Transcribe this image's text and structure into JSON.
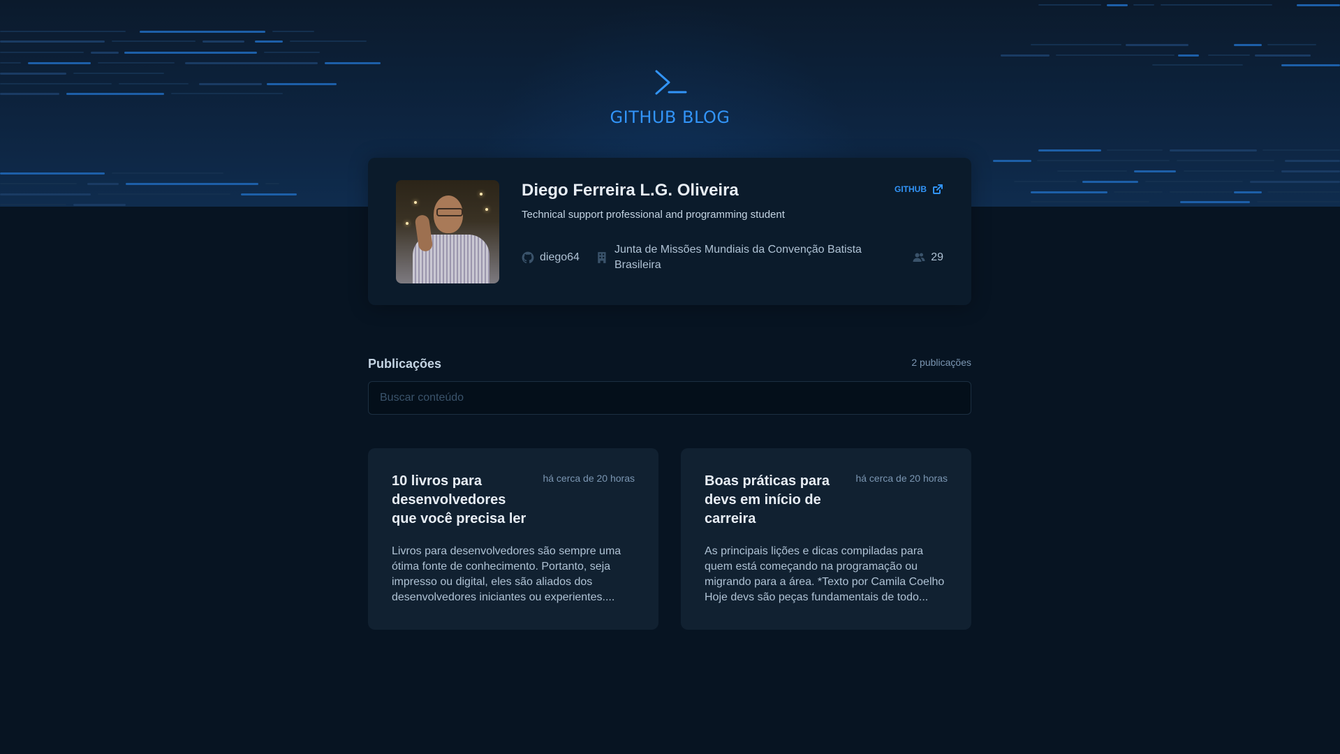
{
  "header": {
    "title": "GITHUB BLOG",
    "icon": "terminal-prompt-icon",
    "accent_color": "#3294f8"
  },
  "profile": {
    "name": "Diego Ferreira L.G. Oliveira",
    "bio": "Technical support professional and programming student",
    "github_label": "GITHUB",
    "login": "diego64",
    "company": "Junta de Missões Mundiais da Convenção Batista Brasileira",
    "followers": "29"
  },
  "publications": {
    "title": "Publicações",
    "count_label": "2 publicações",
    "search_placeholder": "Buscar conteúdo",
    "search_value": ""
  },
  "posts": [
    {
      "title": "10 livros para desenvolvedores que você precisa ler",
      "date": "há cerca de 20 horas",
      "excerpt": "Livros para desenvolvedores são sempre uma ótima fonte de conhecimento. Portanto, seja impresso ou digital, eles são aliados dos desenvolvedores iniciantes ou experientes...."
    },
    {
      "title": "Boas práticas para devs em início de carreira",
      "date": "há cerca de 20 horas",
      "excerpt": "As principais lições e dicas compiladas para quem está começando na programação ou migrando para a área. *Texto por Camila Coelho Hoje devs são peças fundamentais de todo..."
    }
  ]
}
